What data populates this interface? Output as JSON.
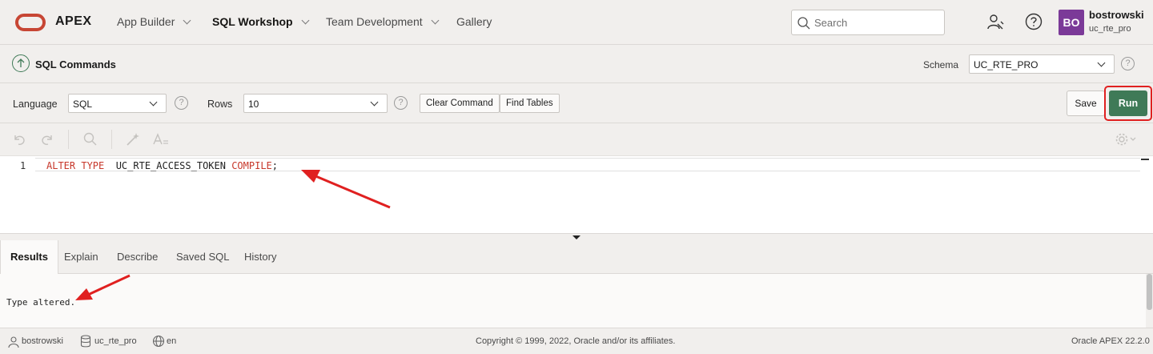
{
  "header": {
    "brand": "APEX",
    "nav": [
      {
        "label": "App Builder"
      },
      {
        "label": "SQL Workshop"
      },
      {
        "label": "Team Development"
      },
      {
        "label": "Gallery"
      }
    ],
    "search_placeholder": "Search",
    "avatar_initials": "BO",
    "user_name": "bostrowski",
    "user_schema": "uc_rte_pro"
  },
  "titlebar": {
    "title": "SQL Commands",
    "schema_label": "Schema",
    "schema_value": "UC_RTE_PRO"
  },
  "toolbar": {
    "language_label": "Language",
    "language_value": "SQL",
    "rows_label": "Rows",
    "rows_value": "10",
    "clear_label": "Clear Command",
    "find_label": "Find Tables",
    "save_label": "Save",
    "run_label": "Run"
  },
  "editor": {
    "line_number": "1",
    "kw1": "ALTER TYPE",
    "object": "  UC_RTE_ACCESS_TOKEN ",
    "kw2": "COMPILE",
    "end": ";"
  },
  "results": {
    "tabs": [
      {
        "label": "Results"
      },
      {
        "label": "Explain"
      },
      {
        "label": "Describe"
      },
      {
        "label": "Saved SQL"
      },
      {
        "label": "History"
      }
    ],
    "message": "Type altered."
  },
  "footer": {
    "user": "bostrowski",
    "schema": "uc_rte_pro",
    "language": "en",
    "copyright": "Copyright © 1999, 2022, Oracle and/or its affiliates.",
    "version": "Oracle APEX 22.2.0"
  },
  "colors": {
    "accent_red": "#c74634",
    "run_green": "#3f7a57",
    "avatar_purple": "#7b3a98",
    "annotation_red": "#e02020"
  }
}
